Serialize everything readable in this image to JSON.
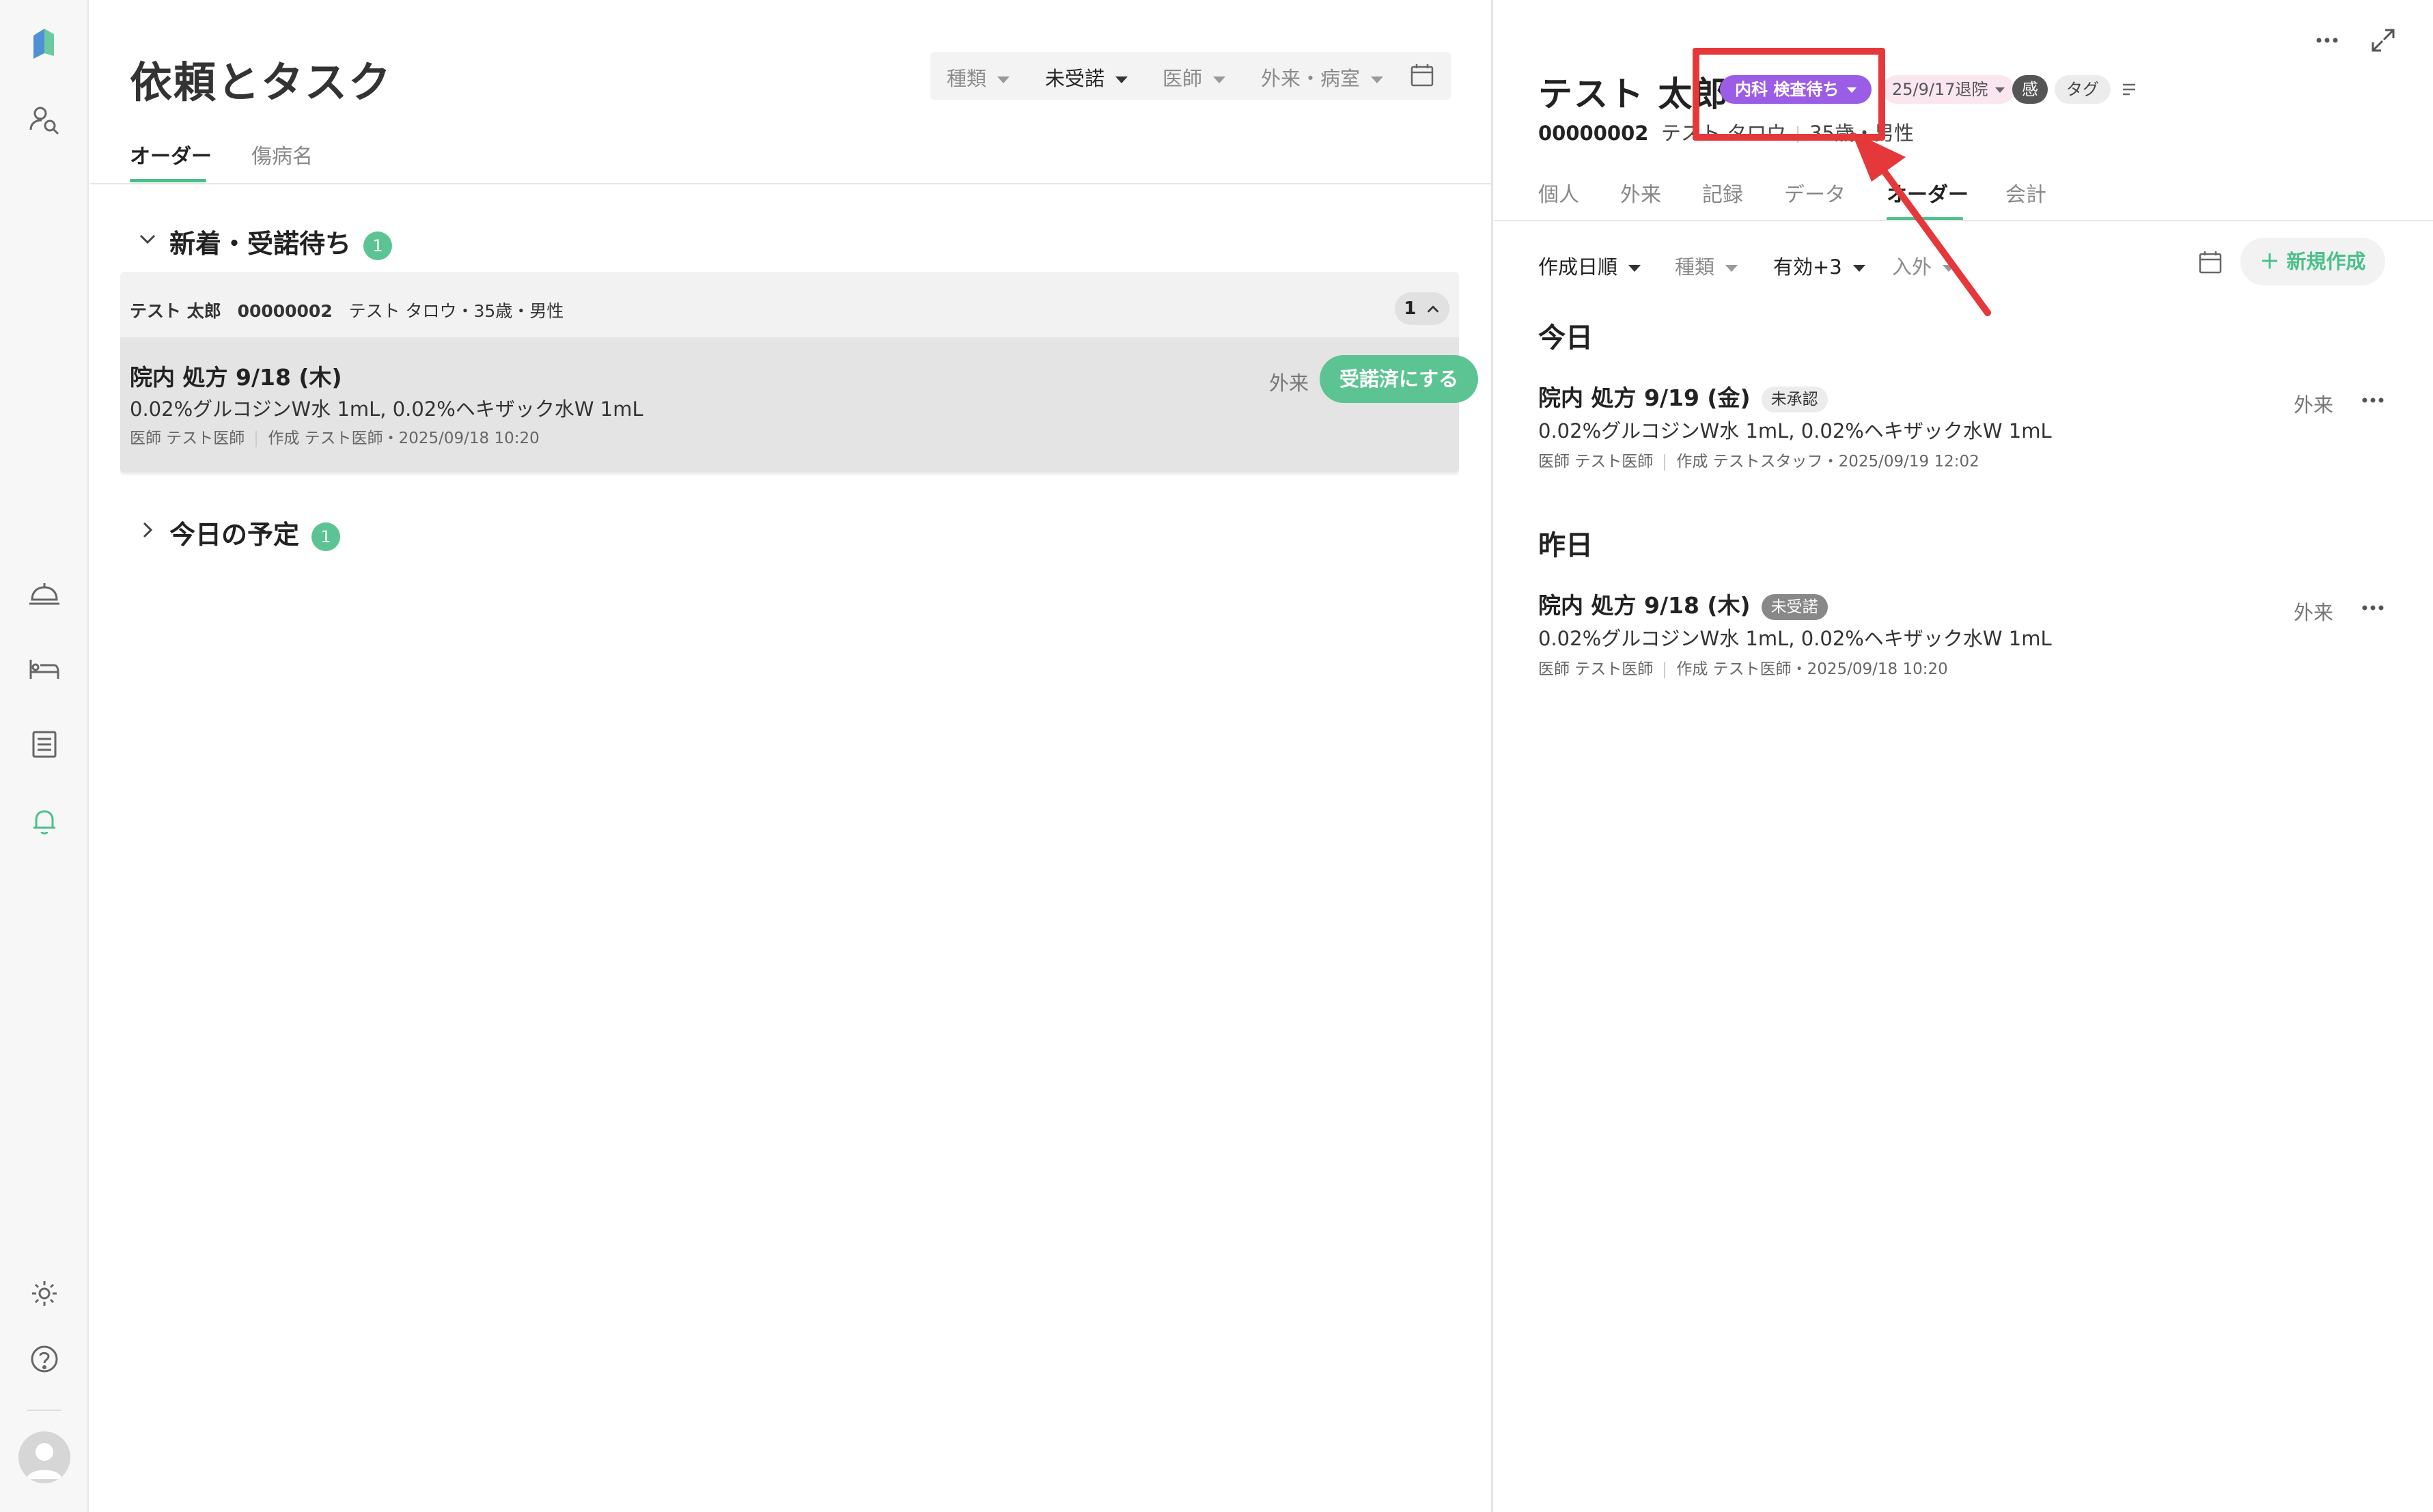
{
  "sidebar": {
    "items": [
      "logo-icon",
      "patient-search-icon",
      "service-bell-icon",
      "bed-icon",
      "list-icon",
      "bell-icon",
      "gear-icon",
      "help-icon",
      "avatar"
    ]
  },
  "left": {
    "title": "依頼とタスク",
    "filters": [
      {
        "label": "種類",
        "active": false
      },
      {
        "label": "未受諾",
        "active": true
      },
      {
        "label": "医師",
        "active": false
      },
      {
        "label": "外来・病室",
        "active": false
      }
    ],
    "tabs": [
      {
        "label": "オーダー",
        "active": true
      },
      {
        "label": "傷病名",
        "active": false
      }
    ],
    "section_new": {
      "label": "新着・受諾待ち",
      "count": "1"
    },
    "group": {
      "patient_name": "テスト 太郎",
      "patient_id": "00000002",
      "patient_info": "テスト タロウ・35歳・男性",
      "count": "1"
    },
    "order": {
      "title": "院内 処方  9/18 (木)",
      "drugs": "0.02%グルコジンW水 1mL, 0.02%ヘキザック水W 1mL",
      "doctor": "医師 テスト医師",
      "created": "作成 テスト医師・2025/09/18 10:20",
      "place": "外来",
      "accept_label": "受諾済にする"
    },
    "section_today": {
      "label": "今日の予定",
      "count": "1"
    }
  },
  "right": {
    "patient_name": "テスト 太郎",
    "status": "内科 検査待ち",
    "discharge": "25/9/17退院",
    "kan": "感",
    "tag": "タグ",
    "patient_id": "00000002",
    "kana": "テスト タロウ",
    "age": "35歳",
    "sex": "男性",
    "tabs": [
      {
        "label": "個人",
        "active": false
      },
      {
        "label": "外来",
        "active": false
      },
      {
        "label": "記録",
        "active": false
      },
      {
        "label": "データ",
        "active": false
      },
      {
        "label": "オーダー",
        "active": true
      },
      {
        "label": "会計",
        "active": false
      }
    ],
    "filters": [
      {
        "label": "作成日順",
        "active": true
      },
      {
        "label": "種類",
        "active": false
      },
      {
        "label": "有効+3",
        "active": true
      },
      {
        "label": "入外",
        "active": false
      }
    ],
    "new_label": "新規作成",
    "today": {
      "label": "今日",
      "title": "院内 処方  9/19 (金)",
      "badge": "未承認",
      "drugs": "0.02%グルコジンW水 1mL, 0.02%ヘキザック水W 1mL",
      "doctor": "医師 テスト医師",
      "created": "作成 テストスタッフ・2025/09/19 12:02",
      "place": "外来"
    },
    "yesterday": {
      "label": "昨日",
      "title": "院内 処方  9/18 (木)",
      "badge": "未受諾",
      "drugs": "0.02%グルコジンW水 1mL, 0.02%ヘキザック水W 1mL",
      "doctor": "医師 テスト医師",
      "created": "作成 テスト医師・2025/09/18 10:20",
      "place": "外来"
    }
  },
  "colors": {
    "accent": "#5cc492",
    "status_purple": "#9b5de5",
    "annotation_red": "#e5383b"
  }
}
